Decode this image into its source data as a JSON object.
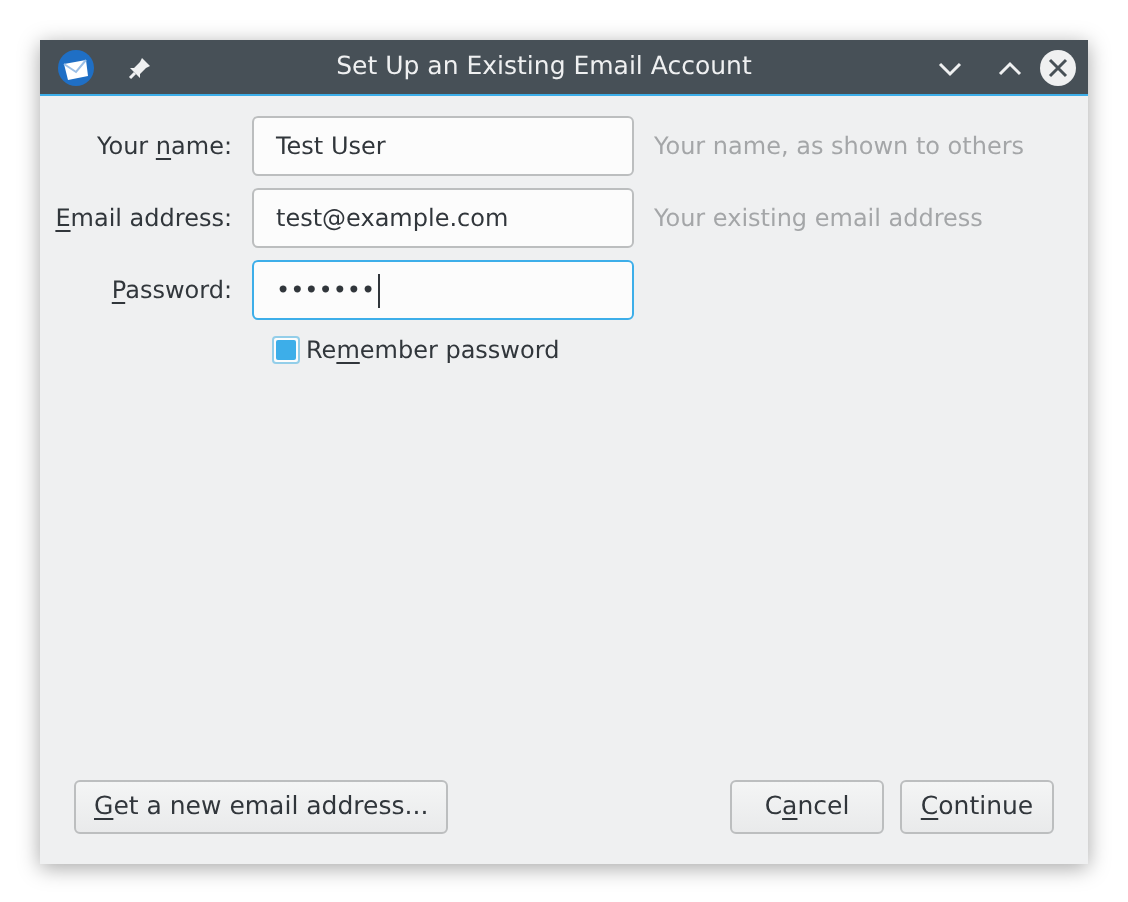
{
  "window": {
    "title": "Set Up an Existing Email Account"
  },
  "fields": [
    {
      "label": {
        "before": "Your ",
        "accel": "n",
        "after": "ame:"
      },
      "value": "Test User",
      "hint": "Your name, as shown to others",
      "focused": false
    },
    {
      "label": {
        "accel": "E",
        "after": "mail address:"
      },
      "value": "test@example.com",
      "hint": "Your existing email address",
      "focused": false
    },
    {
      "label": {
        "accel": "P",
        "after": "assword:"
      },
      "value": "•••••••",
      "focused": true
    }
  ],
  "remember": {
    "label": {
      "before": "Re",
      "accel": "m",
      "after": "ember password"
    },
    "checked": true
  },
  "buttons": [
    {
      "label": {
        "accel": "G",
        "after": "et a new email address..."
      },
      "kind": "left"
    },
    {
      "label": {
        "before": "C",
        "accel": "a",
        "after": "ncel"
      },
      "kind": "right"
    },
    {
      "label": {
        "accel": "C",
        "after": "ontinue"
      },
      "kind": "right"
    }
  ]
}
